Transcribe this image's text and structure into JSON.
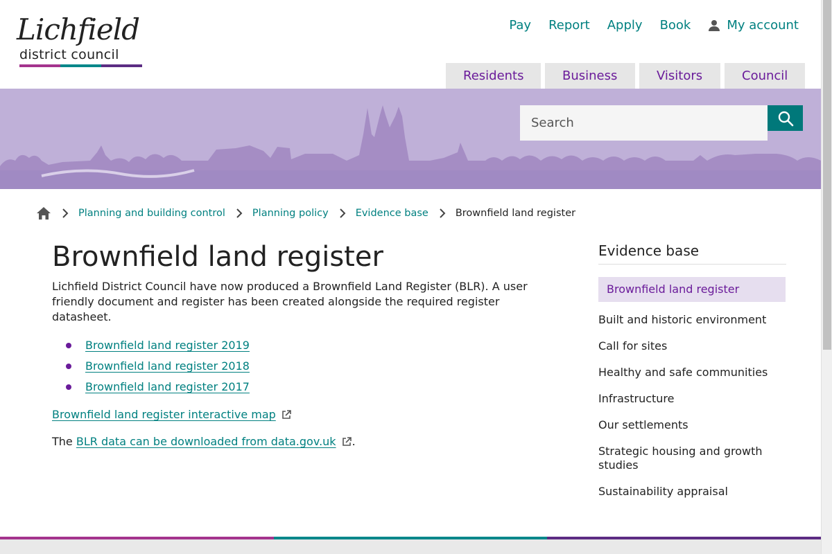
{
  "logo": {
    "script": "Lichfield",
    "subtitle": "district council",
    "bar_colors": [
      "#a4348d",
      "#00878a",
      "#5c2d83"
    ]
  },
  "utility_nav": [
    "Pay",
    "Report",
    "Apply",
    "Book"
  ],
  "account": {
    "label": "My account",
    "icon": "user-icon"
  },
  "main_nav": [
    "Residents",
    "Business",
    "Visitors",
    "Council"
  ],
  "search": {
    "placeholder": "Search",
    "icon": "search-icon"
  },
  "breadcrumb": {
    "home_icon": "home-icon",
    "items": [
      "Planning and building control",
      "Planning policy",
      "Evidence base"
    ],
    "current": "Brownfield land register"
  },
  "main": {
    "title": "Brownfield land register",
    "intro": "Lichfield District Council have now produced a Brownfield Land Register (BLR). A user friendly document and register has been created alongside the required register datasheet.",
    "links": [
      "Brownfield land register 2019",
      "Brownfield land register 2018",
      "Brownfield land register 2017"
    ],
    "map_link": "Brownfield land register interactive map",
    "download_prefix": "The",
    "download_link": "BLR data can be downloaded from data.gov.uk",
    "download_suffix": "."
  },
  "sidebar": {
    "title": "Evidence base",
    "items": [
      "Brownfield land register",
      "Built and historic environment",
      "Call for sites",
      "Healthy and safe communities",
      "Infrastructure",
      "Our settlements",
      "Strategic housing and growth studies",
      "Sustainability appraisal"
    ]
  },
  "colors": {
    "teal": "#008080",
    "purple": "#6a1b9a",
    "banner": "#bfb0d8",
    "search_button": "#00787a"
  }
}
